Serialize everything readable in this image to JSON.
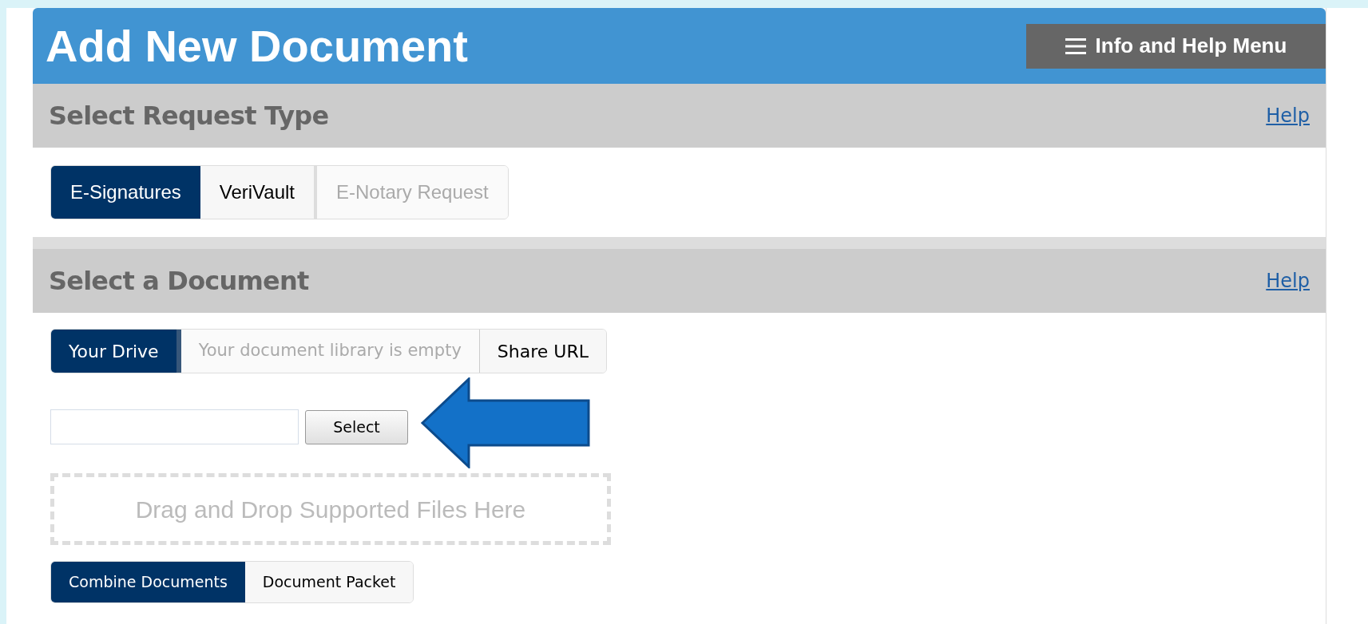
{
  "header": {
    "title": "Add New Document",
    "menu_button": "Info and Help Menu"
  },
  "sections": [
    {
      "title": "Select Request Type",
      "help_link": "Help",
      "tabs": [
        {
          "label": "E-Signatures",
          "selected": true,
          "disabled": false
        },
        {
          "label": "VeriVault",
          "selected": false,
          "disabled": false
        },
        {
          "label": "E-Notary Request",
          "selected": false,
          "disabled": true
        }
      ]
    },
    {
      "title": "Select a Document",
      "help_link": "Help",
      "tabs": [
        {
          "kind": "tab",
          "label": "Your Drive",
          "selected": true
        },
        {
          "kind": "note",
          "label": "Your document library is empty"
        },
        {
          "kind": "tab",
          "label": "Share URL",
          "selected": false
        }
      ],
      "file_picker": {
        "button": "Select"
      },
      "dropzone": "Drag and Drop Supported Files Here",
      "mode_tabs": [
        {
          "label": "Combine Documents",
          "selected": true
        },
        {
          "label": "Document Packet",
          "selected": false
        }
      ]
    }
  ]
}
